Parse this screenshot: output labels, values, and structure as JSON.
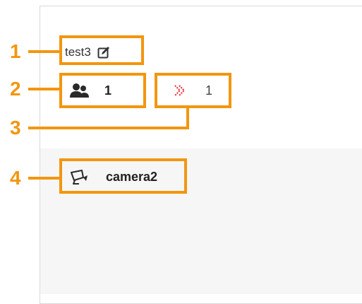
{
  "group": {
    "name": "test3",
    "edit_icon": "edit-icon"
  },
  "stats": {
    "users_count": "1",
    "users_icon": "users-icon",
    "alerts_count": "1",
    "alerts_icon": "alert-icon",
    "alerts_color": "#e8262d"
  },
  "camera": {
    "name": "camera2",
    "icon": "camera-icon"
  },
  "callouts": {
    "labels": [
      "1",
      "2",
      "3",
      "4"
    ],
    "color": "#f2960f"
  }
}
